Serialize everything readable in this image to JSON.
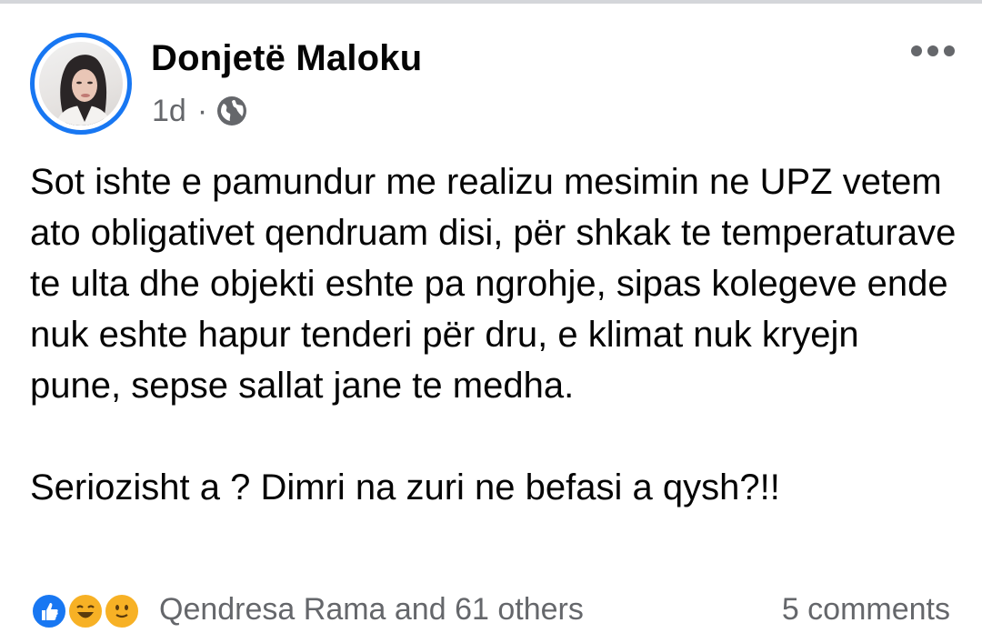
{
  "post": {
    "author_name": "Donjetë Maloku",
    "time": "1d",
    "meta_separator": "·",
    "audience_icon": "globe-icon",
    "more_icon": "more-horizontal-icon",
    "paragraphs": [
      "Sot ishte e pamundur me realizu mesimin ne UPZ vetem ato obligativet qendruam disi, për shkak te temperaturave te ulta dhe objekti eshte pa ngrohje, sipas kolegeve ende nuk eshte hapur tenderi për dru, e klimat nuk kryejn pune, sepse sallat jane te medha.",
      "Seriozisht a ? Dimri na zuri ne befasi a qysh?!!"
    ]
  },
  "reactions": {
    "icons": [
      "like-icon",
      "haha-icon",
      "care-icon"
    ],
    "summary": "Qendresa Rama and 61 others",
    "comments": "5 comments"
  },
  "colors": {
    "accent": "#1877f2",
    "text_primary": "#050505",
    "text_secondary": "#65676b",
    "divider": "#d4d6da",
    "reaction_yellow": "#f7b125"
  }
}
